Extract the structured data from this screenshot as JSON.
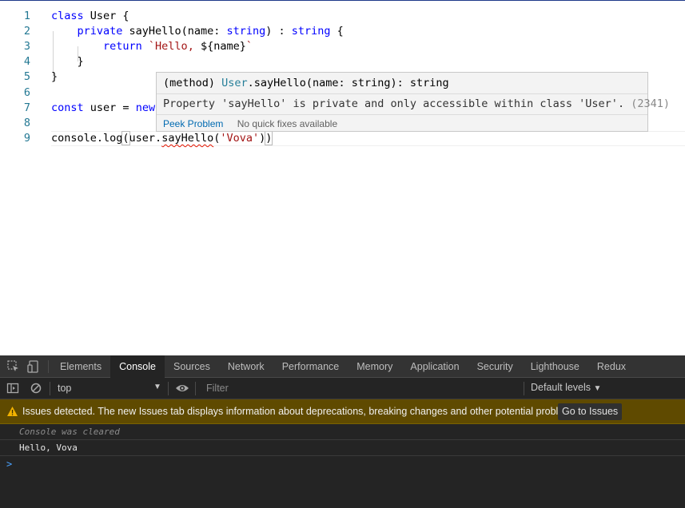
{
  "editor": {
    "lines": [
      {
        "num": "1",
        "parts": [
          {
            "t": "class ",
            "c": "kw"
          },
          {
            "t": "User {",
            "c": ""
          }
        ]
      },
      {
        "num": "2",
        "parts": [
          {
            "t": "    private ",
            "c": "kw"
          },
          {
            "t": "sayHello(name: ",
            "c": ""
          },
          {
            "t": "string",
            "c": "kw"
          },
          {
            "t": ") : ",
            "c": ""
          },
          {
            "t": "string",
            "c": "kw"
          },
          {
            "t": " {",
            "c": ""
          }
        ]
      },
      {
        "num": "3",
        "parts": [
          {
            "t": "        return ",
            "c": "kw"
          },
          {
            "t": "`Hello, ",
            "c": "str"
          },
          {
            "t": "${name}",
            "c": ""
          },
          {
            "t": "`",
            "c": "str"
          }
        ]
      },
      {
        "num": "4",
        "parts": [
          {
            "t": "    }",
            "c": ""
          }
        ]
      },
      {
        "num": "5",
        "parts": [
          {
            "t": "}",
            "c": ""
          }
        ]
      },
      {
        "num": "6",
        "parts": []
      },
      {
        "num": "7",
        "parts": [
          {
            "t": "const ",
            "c": "kw"
          },
          {
            "t": "user = ",
            "c": ""
          },
          {
            "t": "new",
            "c": "kw"
          }
        ]
      },
      {
        "num": "8",
        "parts": []
      },
      {
        "num": "9",
        "parts": [
          {
            "t": "console.log",
            "c": ""
          },
          {
            "t": "(",
            "c": "bracket"
          },
          {
            "t": "user.",
            "c": ""
          },
          {
            "t": "sayHello",
            "c": "squig"
          },
          {
            "t": "(",
            "c": ""
          },
          {
            "t": "'Vova'",
            "c": "str"
          },
          {
            "t": ")",
            "c": ""
          },
          {
            "t": ")",
            "c": "bracket"
          }
        ]
      }
    ]
  },
  "hover": {
    "sig_prefix": "(method) ",
    "sig_class": "User",
    "sig_rest": ".sayHello(name: string): string",
    "message": "Property 'sayHello' is private and only accessible within class 'User'.",
    "error_code": "(2341)",
    "peek_label": "Peek Problem",
    "no_fix_label": "No quick fixes available"
  },
  "devtools": {
    "tabs": [
      "Elements",
      "Console",
      "Sources",
      "Network",
      "Performance",
      "Memory",
      "Application",
      "Security",
      "Lighthouse",
      "Redux"
    ],
    "active_tab": "Console",
    "context": "top",
    "filter_placeholder": "Filter",
    "levels": "Default levels",
    "issues_text": "Issues detected. The new Issues tab displays information about deprecations, breaking changes and other potential problems.",
    "issues_button": "Go to Issues",
    "console_cleared": "Console was cleared",
    "output": "Hello, Vova",
    "prompt": ">"
  },
  "colors": {
    "keyword": "#0000ff",
    "string": "#a31515",
    "line_number": "#237893",
    "issues_bg": "#5f4a00"
  }
}
